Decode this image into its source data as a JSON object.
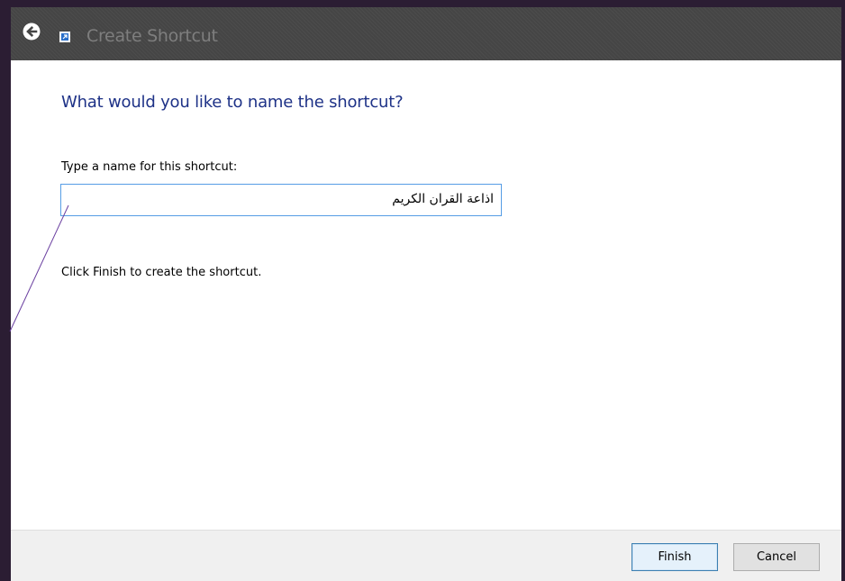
{
  "window": {
    "title": "Create Shortcut",
    "back_icon": "back-arrow-icon",
    "app_icon": "shortcut-icon"
  },
  "main": {
    "heading": "What would you like to name the shortcut?",
    "name_label": "Type a name for this shortcut:",
    "name_value": "اذاعة القران الكريم",
    "hint": "Click Finish to create the shortcut."
  },
  "footer": {
    "finish_label": "Finish",
    "cancel_label": "Cancel"
  },
  "colors": {
    "heading": "#1e3287",
    "titlebar": "#454545",
    "input_border": "#569de5",
    "annotation_line": "#6a3fa0"
  }
}
